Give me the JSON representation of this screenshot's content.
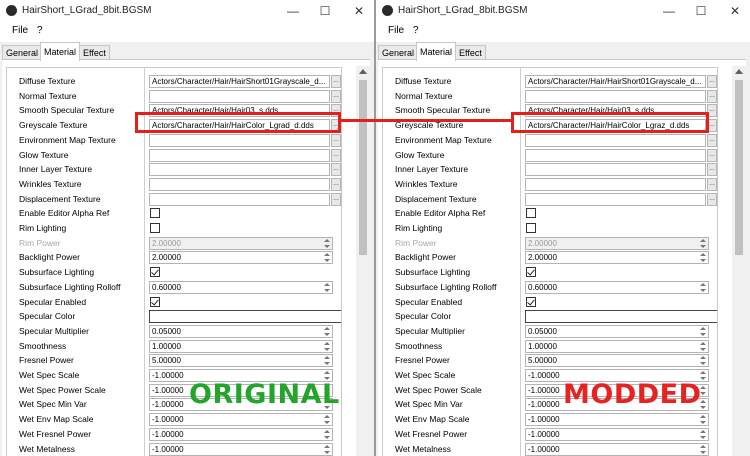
{
  "windows": [
    {
      "title": "HairShort_LGrad_8bit.BGSM",
      "menu": [
        "File",
        "?"
      ],
      "tabs": [
        "General",
        "Material",
        "Effect"
      ],
      "active_tab": "Material",
      "watermark": "ORIGINAL",
      "rows": [
        {
          "label": "Diffuse Texture",
          "type": "texture",
          "value": "Actors/Character/Hair/HairShort01Grayscale_d..."
        },
        {
          "label": "Normal Texture",
          "type": "texture",
          "value": ""
        },
        {
          "label": "Smooth Specular Texture",
          "type": "texture",
          "value": "Actors/Character/Hair/Hair03_s.dds"
        },
        {
          "label": "Greyscale Texture",
          "type": "texture",
          "value": "Actors/Character/Hair/HairColor_Lgrad_d.dds"
        },
        {
          "label": "Environment Map Texture",
          "type": "texture",
          "value": ""
        },
        {
          "label": "Glow Texture",
          "type": "texture",
          "value": ""
        },
        {
          "label": "Inner Layer Texture",
          "type": "texture",
          "value": ""
        },
        {
          "label": "Wrinkles Texture",
          "type": "texture",
          "value": ""
        },
        {
          "label": "Displacement Texture",
          "type": "texture",
          "value": ""
        },
        {
          "label": "Enable Editor Alpha Ref",
          "type": "checkbox",
          "checked": false
        },
        {
          "label": "Rim Lighting",
          "type": "checkbox",
          "checked": false
        },
        {
          "label": "Rim Power",
          "type": "number",
          "value": "2.00000",
          "disabled": true
        },
        {
          "label": "Backlight Power",
          "type": "number",
          "value": "2.00000"
        },
        {
          "label": "Subsurface Lighting",
          "type": "checkbox",
          "checked": true
        },
        {
          "label": "Subsurface Lighting Rolloff",
          "type": "number",
          "value": "0.60000"
        },
        {
          "label": "Specular Enabled",
          "type": "checkbox",
          "checked": true
        },
        {
          "label": "Specular Color",
          "type": "color",
          "value": ""
        },
        {
          "label": "Specular Multiplier",
          "type": "number",
          "value": "0.05000"
        },
        {
          "label": "Smoothness",
          "type": "number",
          "value": "1.00000"
        },
        {
          "label": "Fresnel Power",
          "type": "number",
          "value": "5.00000"
        },
        {
          "label": "Wet Spec Scale",
          "type": "number",
          "value": "-1.00000"
        },
        {
          "label": "Wet Spec Power Scale",
          "type": "number",
          "value": "-1.00000"
        },
        {
          "label": "Wet Spec Min Var",
          "type": "number",
          "value": "-1.00000"
        },
        {
          "label": "Wet Env Map Scale",
          "type": "number",
          "value": "-1.00000"
        },
        {
          "label": "Wet Fresnel Power",
          "type": "number",
          "value": "-1.00000"
        },
        {
          "label": "Wet Metalness",
          "type": "number",
          "value": "-1.00000"
        }
      ]
    },
    {
      "title": "HairShort_LGrad_8bit.BGSM",
      "menu": [
        "File",
        "?"
      ],
      "tabs": [
        "General",
        "Material",
        "Effect"
      ],
      "active_tab": "Material",
      "watermark": "MODDED",
      "rows": [
        {
          "label": "Diffuse Texture",
          "type": "texture",
          "value": "Actors/Character/Hair/HairShort01Grayscale_d..."
        },
        {
          "label": "Normal Texture",
          "type": "texture",
          "value": ""
        },
        {
          "label": "Smooth Specular Texture",
          "type": "texture",
          "value": "Actors/Character/Hair/Hair03_s.dds"
        },
        {
          "label": "Greyscale Texture",
          "type": "texture",
          "value": "Actors/Character/Hair/HairColor_Lgraz_d.dds"
        },
        {
          "label": "Environment Map Texture",
          "type": "texture",
          "value": ""
        },
        {
          "label": "Glow Texture",
          "type": "texture",
          "value": ""
        },
        {
          "label": "Inner Layer Texture",
          "type": "texture",
          "value": ""
        },
        {
          "label": "Wrinkles Texture",
          "type": "texture",
          "value": ""
        },
        {
          "label": "Displacement Texture",
          "type": "texture",
          "value": ""
        },
        {
          "label": "Enable Editor Alpha Ref",
          "type": "checkbox",
          "checked": false
        },
        {
          "label": "Rim Lighting",
          "type": "checkbox",
          "checked": false
        },
        {
          "label": "Rim Power",
          "type": "number",
          "value": "2.00000",
          "disabled": true
        },
        {
          "label": "Backlight Power",
          "type": "number",
          "value": "2.00000"
        },
        {
          "label": "Subsurface Lighting",
          "type": "checkbox",
          "checked": true
        },
        {
          "label": "Subsurface Lighting Rolloff",
          "type": "number",
          "value": "0.60000"
        },
        {
          "label": "Specular Enabled",
          "type": "checkbox",
          "checked": true
        },
        {
          "label": "Specular Color",
          "type": "color",
          "value": ""
        },
        {
          "label": "Specular Multiplier",
          "type": "number",
          "value": "0.05000"
        },
        {
          "label": "Smoothness",
          "type": "number",
          "value": "1.00000"
        },
        {
          "label": "Fresnel Power",
          "type": "number",
          "value": "5.00000"
        },
        {
          "label": "Wet Spec Scale",
          "type": "number",
          "value": "-1.00000"
        },
        {
          "label": "Wet Spec Power Scale",
          "type": "number",
          "value": "-1.00000"
        },
        {
          "label": "Wet Spec Min Var",
          "type": "number",
          "value": "-1.00000"
        },
        {
          "label": "Wet Env Map Scale",
          "type": "number",
          "value": "-1.00000"
        },
        {
          "label": "Wet Fresnel Power",
          "type": "number",
          "value": "-1.00000"
        },
        {
          "label": "Wet Metalness",
          "type": "number",
          "value": "-1.00000"
        }
      ]
    }
  ],
  "icons": {
    "window_controls": [
      "minimize-icon",
      "maximize-icon",
      "close-icon"
    ],
    "browse": "ellipsis-icon",
    "spinner": "spin-arrows-icon"
  },
  "colors": {
    "highlight": "#e2201c",
    "original_label": "#22a52a",
    "modded_label": "#e52421"
  }
}
